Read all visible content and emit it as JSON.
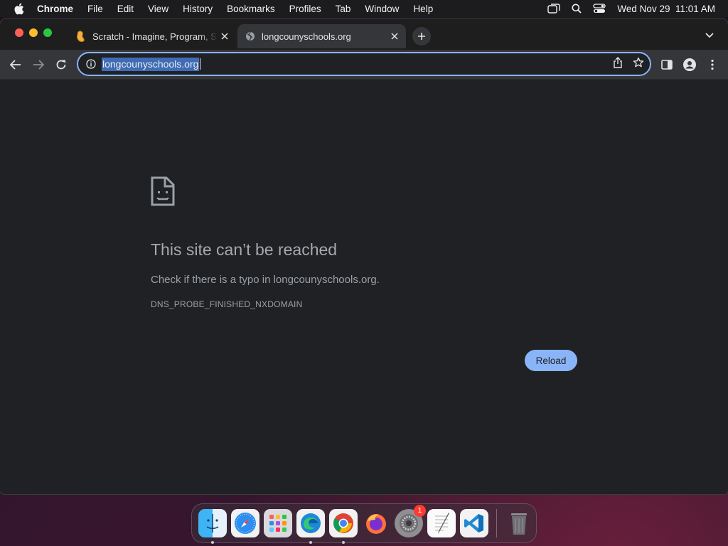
{
  "menubar": {
    "app_name": "Chrome",
    "items": [
      "File",
      "Edit",
      "View",
      "History",
      "Bookmarks",
      "Profiles",
      "Tab",
      "Window",
      "Help"
    ],
    "datetime": "Wed Nov 29  11:01 AM"
  },
  "tabs": [
    {
      "title": "Scratch - Imagine, Program, Share",
      "icon": "scratch-cat-icon",
      "active": false
    },
    {
      "title": "longcounyschools.org",
      "icon": "globe-icon",
      "active": true
    }
  ],
  "toolbar": {
    "url": "longcounyschools.org"
  },
  "error": {
    "title": "This site can’t be reached",
    "description": "Check if there is a typo in longcounyschools.org.",
    "code": "DNS_PROBE_FINISHED_NXDOMAIN",
    "reload_label": "Reload"
  },
  "dock": {
    "apps": [
      "Finder",
      "Safari",
      "Launchpad",
      "Microsoft Edge",
      "Google Chrome",
      "Firefox",
      "System Settings",
      "TextEdit",
      "Visual Studio Code",
      "Trash"
    ],
    "system_settings_badge": "1"
  },
  "colors": {
    "accent": "#8ab4f8",
    "page_bg": "#202124",
    "toolbar_bg": "#35363a"
  }
}
